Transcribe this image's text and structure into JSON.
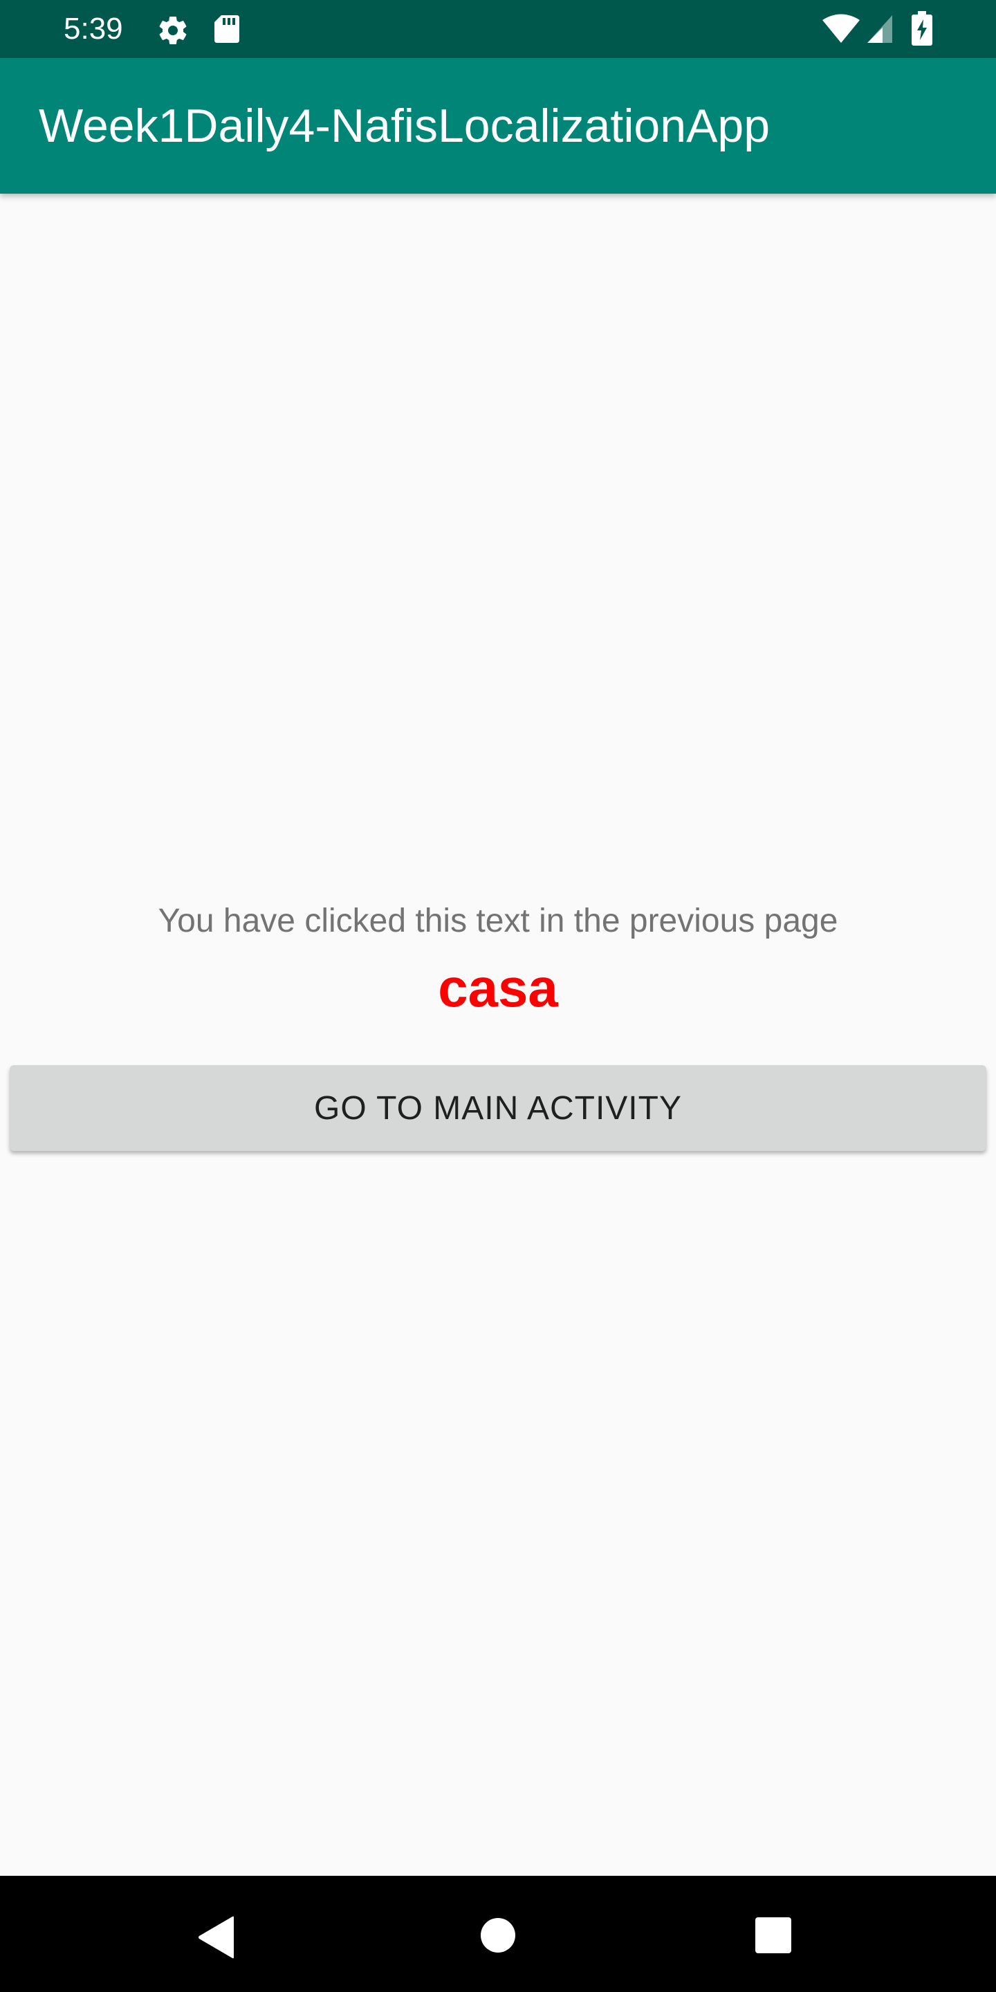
{
  "status_bar": {
    "time": "5:39",
    "icons": [
      "gear-icon",
      "sd-card-icon",
      "wifi-icon",
      "cell-signal-icon",
      "battery-charging-icon"
    ],
    "background_color": "#00574b"
  },
  "app_bar": {
    "title": "Week1Daily4-NafisLocalizationApp",
    "background_color": "#008577"
  },
  "main": {
    "message": "You have clicked this text in the previous page",
    "clicked_word": "casa",
    "clicked_word_color": "#ff0000",
    "button_label": "GO TO MAIN ACTIVITY"
  },
  "nav_bar": {
    "buttons": [
      "back-icon",
      "home-icon",
      "recents-icon"
    ]
  }
}
